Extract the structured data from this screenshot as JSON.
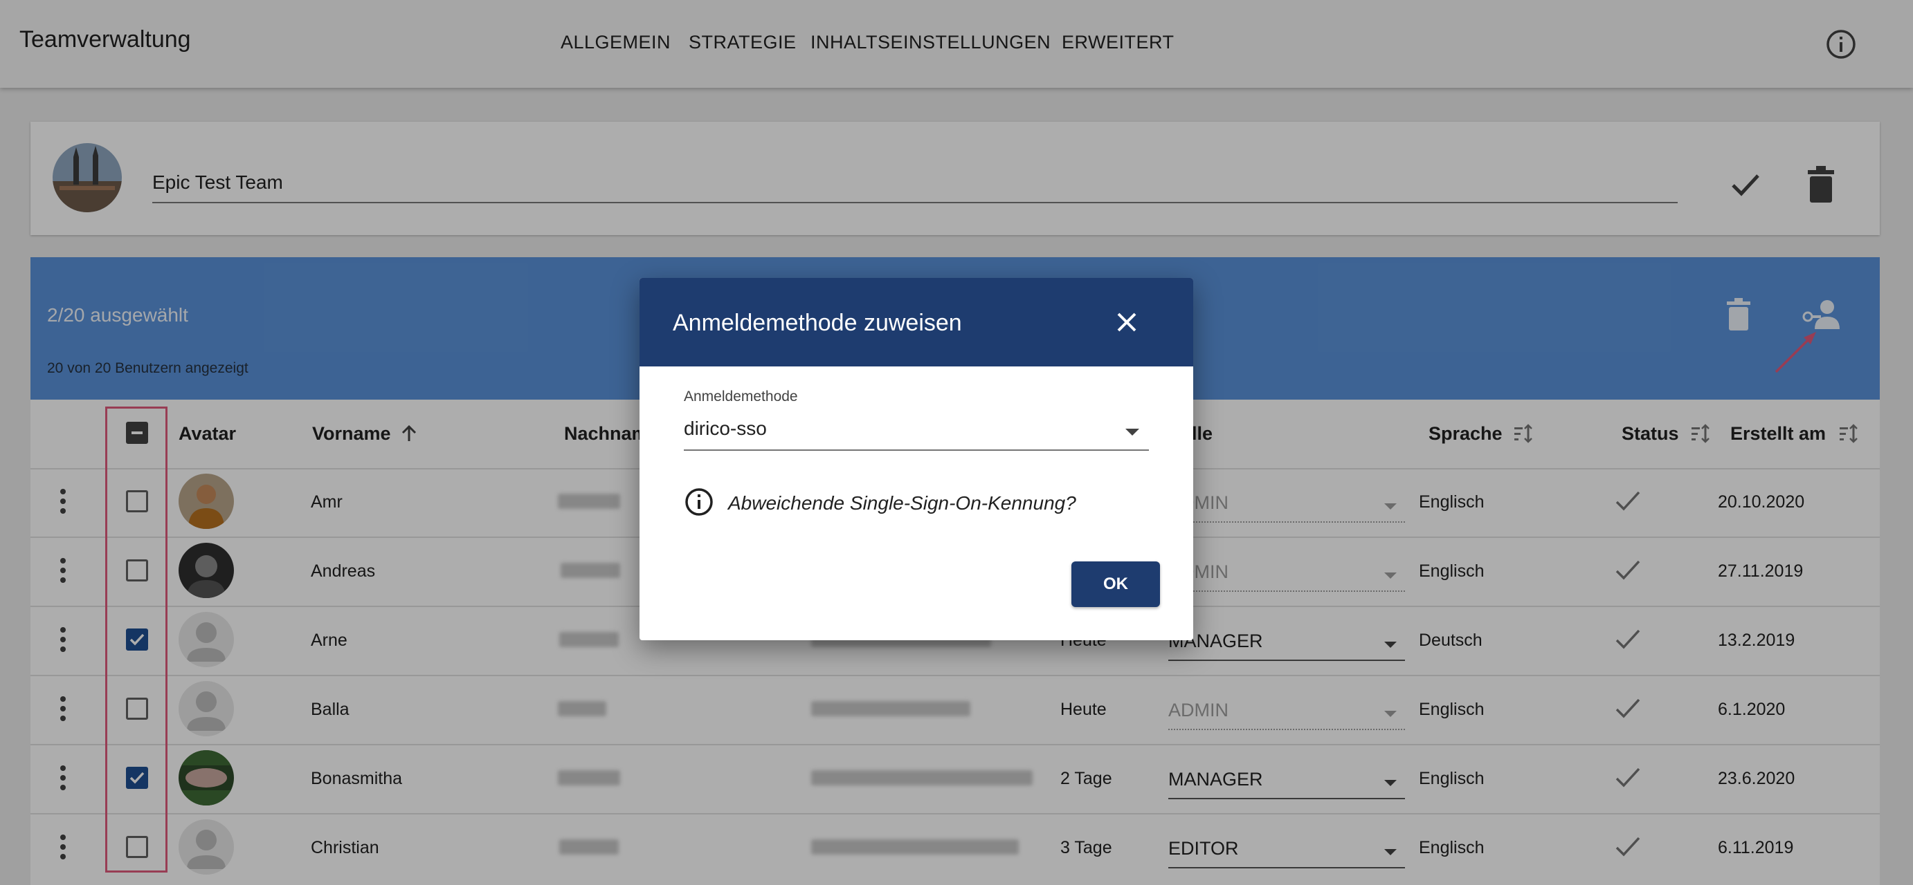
{
  "app": {
    "title": "Teamverwaltung"
  },
  "nav": {
    "tabs": [
      "ALLGEMEIN",
      "STRATEGIE",
      "INHALTSEINSTELLUNGEN",
      "ERWEITERT"
    ]
  },
  "team": {
    "name": "Epic Test Team"
  },
  "selection": {
    "count_label": "2/20 ausgewählt",
    "shown_label": "20 von 20 Benutzern angezeigt"
  },
  "table": {
    "headers": {
      "avatar": "Avatar",
      "vorname": "Vorname",
      "nachname": "Nachname",
      "rolle": "Rolle",
      "sprache": "Sprache",
      "status": "Status",
      "erstellt": "Erstellt am"
    },
    "rows": [
      {
        "vorname": "Amr",
        "last_login": "",
        "role": "ADMIN",
        "sprache": "Englisch",
        "erstellt": "20.10.2020",
        "checked": false
      },
      {
        "vorname": "Andreas",
        "last_login": "",
        "role": "ADMIN",
        "sprache": "Englisch",
        "erstellt": "27.11.2019",
        "checked": false
      },
      {
        "vorname": "Arne",
        "last_login": "Heute",
        "role": "MANAGER",
        "sprache": "Deutsch",
        "erstellt": "13.2.2019",
        "checked": true
      },
      {
        "vorname": "Balla",
        "last_login": "Heute",
        "role": "ADMIN",
        "sprache": "Englisch",
        "erstellt": "6.1.2020",
        "checked": false
      },
      {
        "vorname": "Bonasmitha",
        "last_login": "2 Tage",
        "role": "MANAGER",
        "sprache": "Englisch",
        "erstellt": "23.6.2020",
        "checked": true
      },
      {
        "vorname": "Christian",
        "last_login": "3 Tage",
        "role": "EDITOR",
        "sprache": "Englisch",
        "erstellt": "6.11.2019",
        "checked": false
      }
    ]
  },
  "dialog": {
    "title": "Anmeldemethode zuweisen",
    "field_label": "Anmeldemethode",
    "field_value": "dirico-sso",
    "hint": "Abweichende Single-Sign-On-Kennung?",
    "ok_label": "OK"
  },
  "colors": {
    "primary": "#1e3c6f",
    "selection_bar": "#5b93da",
    "highlight": "#e05a7d",
    "checkbox": "#1e4e92"
  },
  "icons": [
    "info-icon",
    "check-icon",
    "trash-icon",
    "key-person-icon",
    "close-icon",
    "sort-icon",
    "more-vert-icon"
  ]
}
